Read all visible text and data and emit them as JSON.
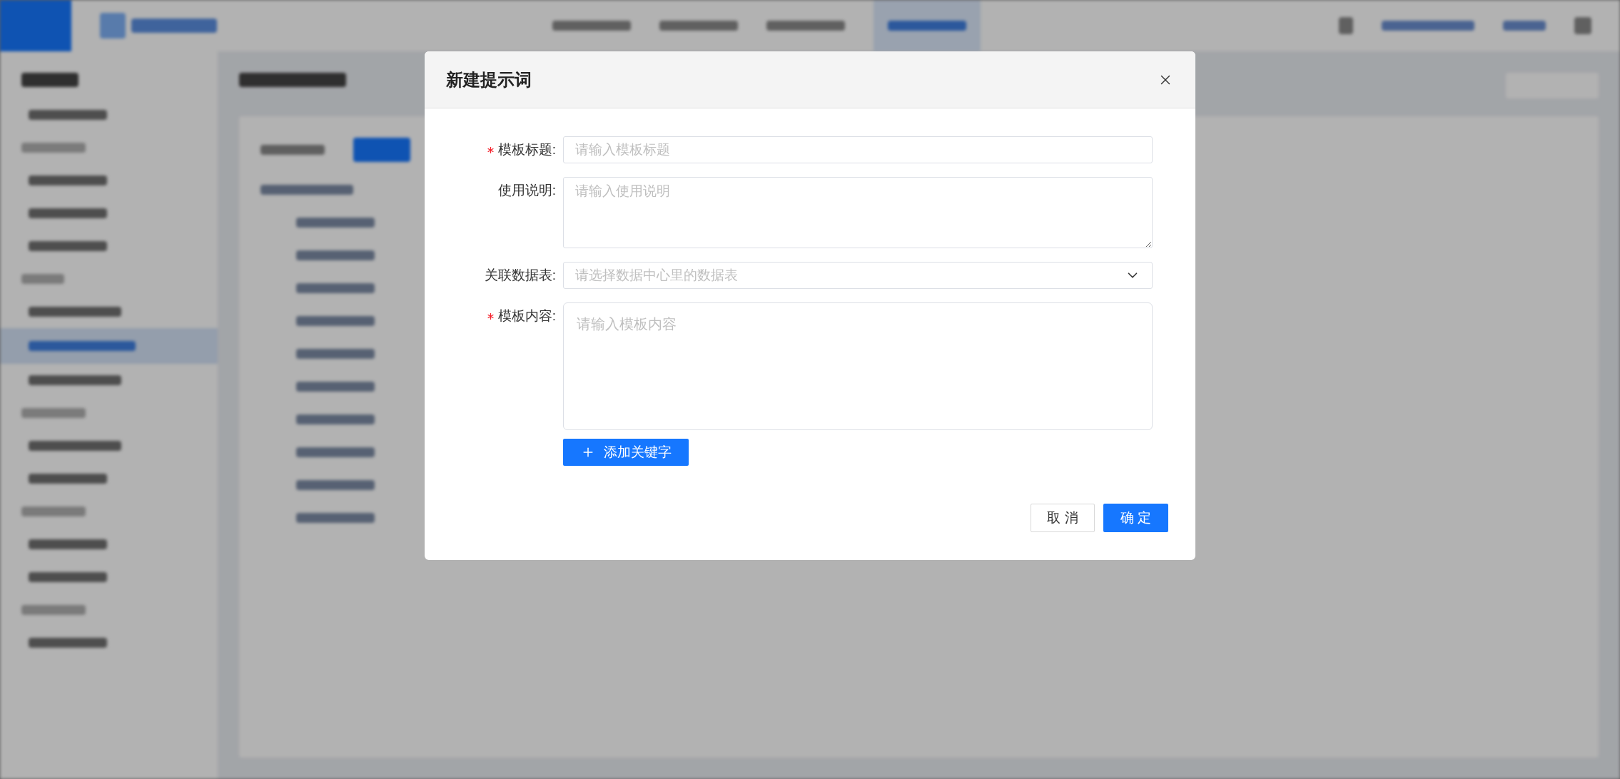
{
  "dialog": {
    "title": "新建提示词",
    "fields": [
      {
        "kind": "input",
        "label": "模板标题:",
        "required": true,
        "placeholder": "请输入模板标题"
      },
      {
        "kind": "textarea",
        "label": "使用说明:",
        "required": false,
        "placeholder": "请输入使用说明"
      },
      {
        "kind": "select",
        "label": "关联数据表:",
        "required": false,
        "placeholder": "请选择数据中心里的数据表"
      },
      {
        "kind": "content",
        "label": "模板内容:",
        "required": true,
        "placeholder": "请输入模板内容"
      }
    ],
    "add_keyword_button": "添加关键字",
    "buttons": [
      {
        "label": "取 消",
        "kind": "secondary"
      },
      {
        "label": "确 定",
        "kind": "primary"
      }
    ]
  }
}
